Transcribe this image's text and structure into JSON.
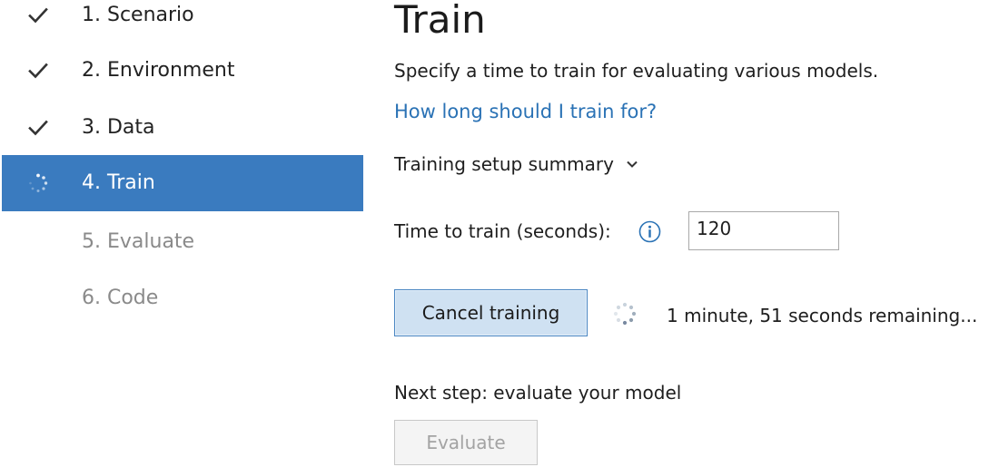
{
  "sidebar": {
    "steps": [
      {
        "label": "1. Scenario",
        "state": "done",
        "icon": "checkmark-icon"
      },
      {
        "label": "2. Environment",
        "state": "done",
        "icon": "checkmark-icon"
      },
      {
        "label": "3. Data",
        "state": "done",
        "icon": "checkmark-icon"
      },
      {
        "label": "4. Train",
        "state": "active",
        "icon": "spinner-icon"
      },
      {
        "label": "5. Evaluate",
        "state": "future"
      },
      {
        "label": "6. Code",
        "state": "future"
      }
    ]
  },
  "main": {
    "title": "Train",
    "subtitle": "Specify a time to train for evaluating various models.",
    "help_link": "How long should I train for?",
    "summary_toggle": "Training setup summary",
    "time_label": "Time to train (seconds):",
    "time_value": "120",
    "cancel_button": "Cancel training",
    "remaining": "1 minute, 51 seconds remaining...",
    "next_step": "Next step: evaluate your model",
    "evaluate_button": "Evaluate"
  },
  "colors": {
    "active_step_bg": "#3a7bbf",
    "link": "#2a72b5",
    "cancel_bg": "#cfe1f2",
    "cancel_border": "#4a86c2",
    "disabled_text": "#a3a3a3",
    "future_step_text": "#8a8a8a"
  }
}
